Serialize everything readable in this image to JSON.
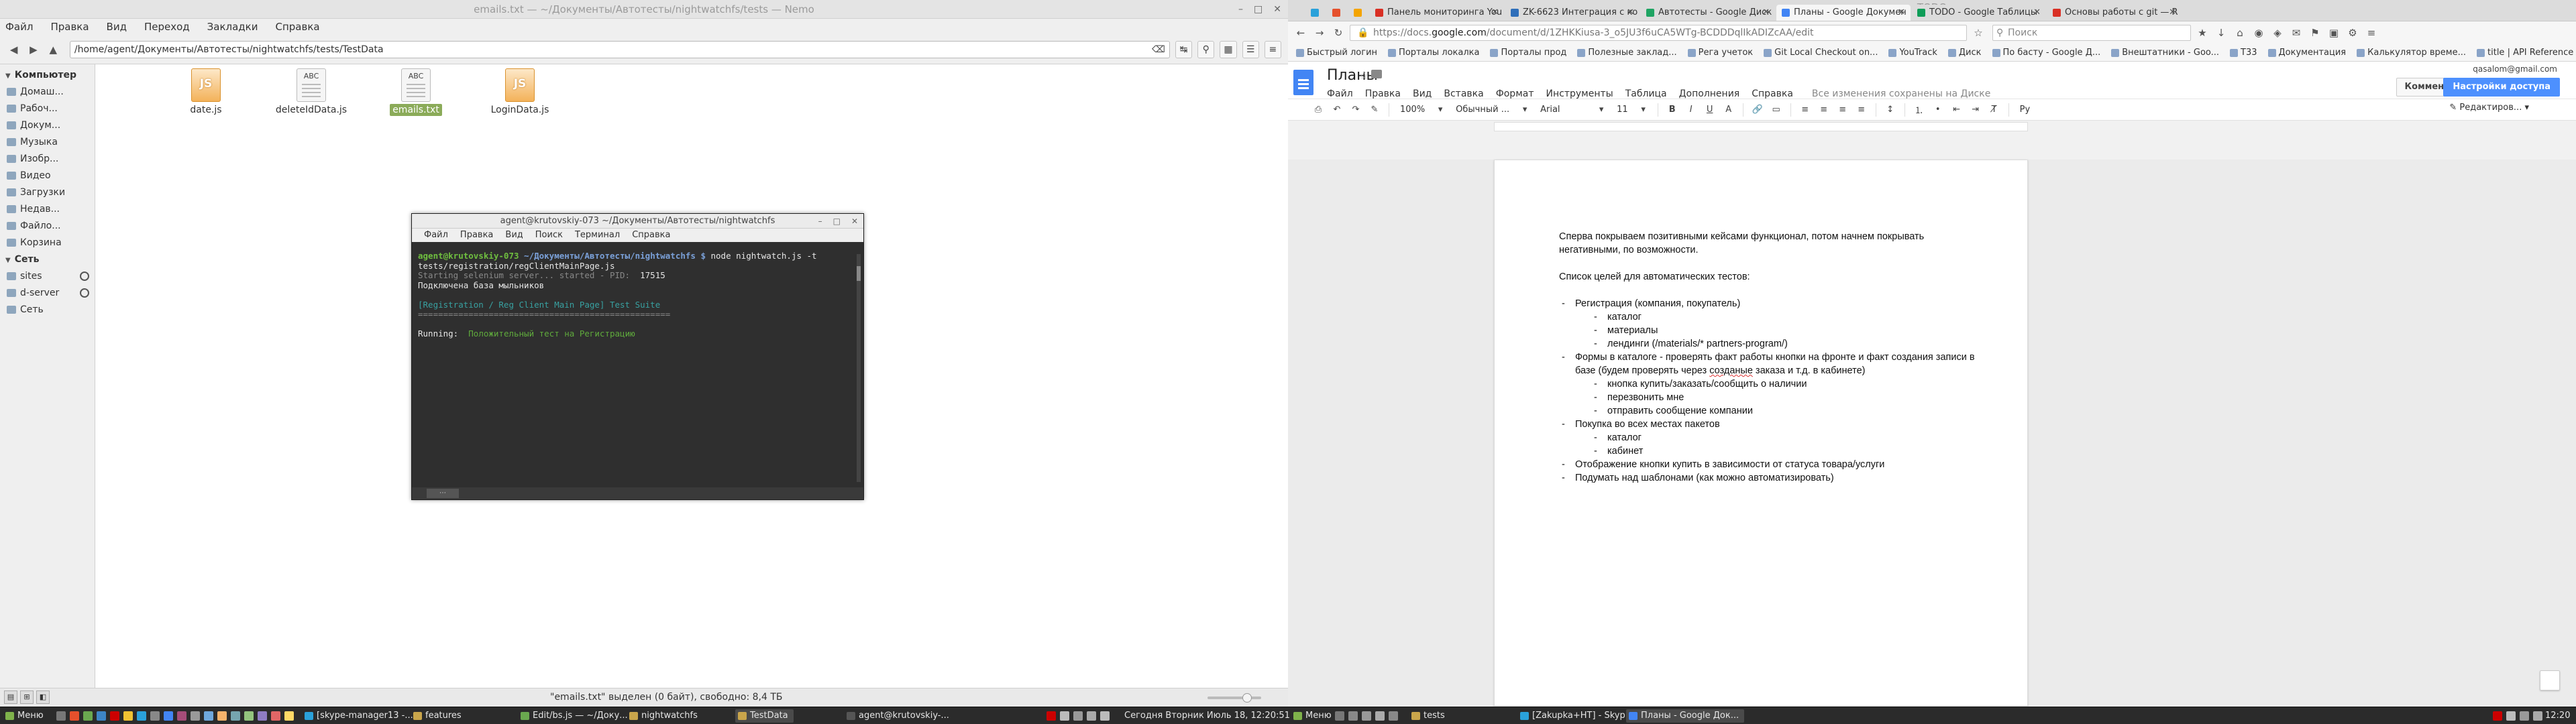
{
  "file_manager": {
    "title": "emails.txt — ~/Документы/Автотесты/nightwatchfs/tests — Nemo",
    "menu": [
      "Файл",
      "Правка",
      "Вид",
      "Переход",
      "Закладки",
      "Справка"
    ],
    "path": "/home/agent/Документы/Автотесты/nightwatchfs/tests/TestData",
    "sidebar": {
      "computer_header": "Компьютер",
      "computer_items": [
        "Домаш...",
        "Рабоч...",
        "Докум...",
        "Музыка",
        "Изобр...",
        "Видео",
        "Загрузки",
        "Недав...",
        "Файло...",
        "Корзина"
      ],
      "network_header": "Сеть",
      "network_items": [
        "sites",
        "d-server",
        "Сеть"
      ]
    },
    "files": [
      {
        "name": "date.js",
        "type": "js",
        "icon": "javascript-file-icon"
      },
      {
        "name": "deleteIdData.js",
        "type": "txt",
        "icon": "text-file-icon"
      },
      {
        "name": "emails.txt",
        "type": "txt",
        "icon": "text-file-icon",
        "selected": true
      },
      {
        "name": "LoginData.js",
        "type": "js",
        "icon": "javascript-file-icon"
      }
    ],
    "status": "\"emails.txt\" выделен (0 байт), свободно: 8,4 ТБ"
  },
  "terminal": {
    "title": "agent@krutovskiy-073 ~/Документы/Автотесты/nightwatchfs",
    "menu": [
      "Файл",
      "Правка",
      "Вид",
      "Поиск",
      "Терминал",
      "Справка"
    ],
    "prompt_user": "agent@krutovskiy-073",
    "prompt_path": "~/Документы/Автотесты/nightwatchfs $",
    "command": " node nightwatch.js -t",
    "command_cont": "tests/registration/regClientMainPage.js",
    "line_selenium": "Starting selenium server... started - PID:",
    "pid": "  17515",
    "line_db": "Подключена база мыльников",
    "line_suite": "[Registration / Reg Client Main Page] Test Suite",
    "line_sep": "==================================================",
    "running_label": "Running:",
    "running_test": "  Положительный тест на Регистрацию"
  },
  "chrome": {
    "window_title": "TODO",
    "tabs": [
      {
        "label": "",
        "pinned": true,
        "color": "#2aa1da"
      },
      {
        "label": "",
        "pinned": true,
        "color": "#e5502c"
      },
      {
        "label": "",
        "pinned": true,
        "color": "#f4a400"
      },
      {
        "label": "Панель мониторинга You",
        "color": "#d93025"
      },
      {
        "label": "ZK-6623 Интеграция с ко",
        "color": "#2f6fba"
      },
      {
        "label": "Автотесты - Google Диск",
        "color": "#1fa463"
      },
      {
        "label": "Планы - Google Докумен",
        "color": "#4285f4",
        "active": true
      },
      {
        "label": "TODO - Google Таблицы",
        "color": "#0f9d58"
      },
      {
        "label": "Основы работы с git — R",
        "color": "#d93025"
      }
    ],
    "url_prefix": "https://docs.",
    "url_host": "google.com",
    "url_rest": "/document/d/1ZHKKiusa-3_o5JU3f6uCA5WTg-BCDDDqlIkADIZcAA/edit",
    "search_placeholder": "Поиск",
    "bookmarks": [
      "Быстрый логин",
      "Порталы локалка",
      "Порталы прод",
      "Полезные заклад...",
      "Рега учеток",
      "Git Local Checkout on...",
      "YouTrack",
      "Диск",
      "По басту - Google Д...",
      "Внештатники - Goo...",
      "T33",
      "Документация",
      "Калькулятор време...",
      "title | API Reference ..."
    ]
  },
  "doc": {
    "title": "Планы",
    "menu": [
      "Файл",
      "Правка",
      "Вид",
      "Вставка",
      "Формат",
      "Инструменты",
      "Таблица",
      "Дополнения",
      "Справка"
    ],
    "saved": "Все изменения сохранены на Диске",
    "user": "qasalom@gmail.com",
    "comments": "Комментарии",
    "share": "Настройки доступа",
    "zoom": "100%",
    "style": "Обычный ...",
    "font": "Arial",
    "size": "11",
    "lang": "Ру",
    "editing": "Редактиров...",
    "p1": "Сперва покрываем позитивными кейсами функционал, потом начнем покрывать негативными, по возможности.",
    "p2": "Список целей для автоматических тестов:",
    "b1": "Регистрация (компания, покупатель)",
    "b1a": "каталог",
    "b1b": "материалы",
    "b1c": "лендинги (/materials/* partners-program/)",
    "b2_pre": "Формы в каталоге - проверять факт работы кнопки на фронте и факт создания записи в базе (будем проверять через ",
    "b2_sq": "созданые",
    "b2_post": " заказа и т.д. в кабинете)",
    "b2a": "кнопка купить/заказать/сообщить о наличии",
    "b2b": "перезвонить мне",
    "b2c": "отправить сообщение компании",
    "b3": "Покупка во всех местах пакетов",
    "b3a": "каталог",
    "b3b": "кабинет",
    "b4": "Отображение кнопки купить в зависимости от статуса товара/услуги",
    "b5": "Подумать над шаблонами (как можно автоматизировать)"
  },
  "taskbar": {
    "menu_label": "Меню",
    "left_items": [
      "[skype-manager13 -...",
      "features",
      "Edit/bs.js — ~/Доку...",
      "nightwatchfs",
      "TestData",
      "agent@krutovskiy-..."
    ],
    "clock": "Сегодня Вторник Июль 18, 12:20:51",
    "right_menu_label": "Меню",
    "right_items": [
      "tests",
      "[Zakupka+HT] - Skyp...",
      "Планы - Google Док..."
    ],
    "time": "12:20"
  }
}
